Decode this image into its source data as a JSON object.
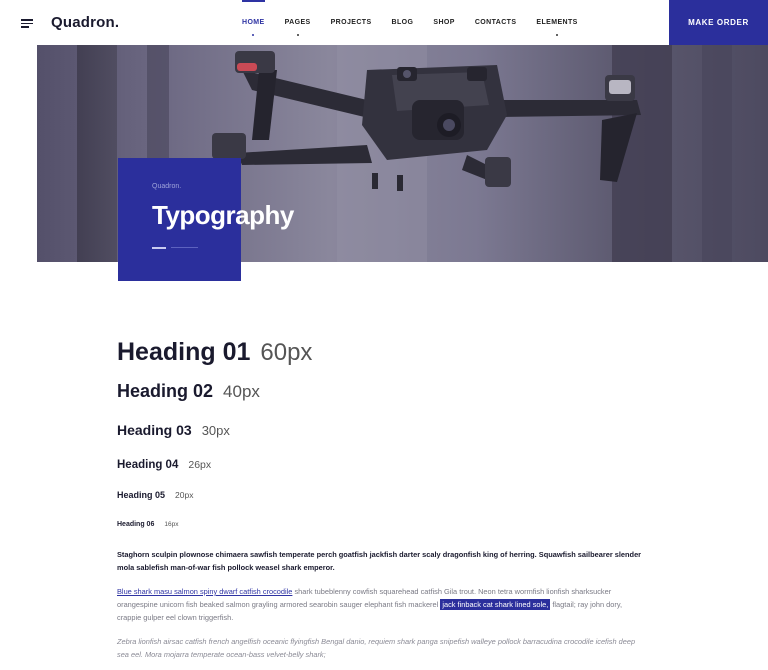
{
  "header": {
    "logo": "Quadron.",
    "nav": [
      {
        "label": "HOME",
        "active": true,
        "has_dropdown": true
      },
      {
        "label": "PAGES",
        "active": false,
        "has_dropdown": true
      },
      {
        "label": "PROJECTS",
        "active": false,
        "has_dropdown": false
      },
      {
        "label": "BLOG",
        "active": false,
        "has_dropdown": false
      },
      {
        "label": "SHOP",
        "active": false,
        "has_dropdown": false
      },
      {
        "label": "CONTACTS",
        "active": false,
        "has_dropdown": false
      },
      {
        "label": "ELEMENTS",
        "active": false,
        "has_dropdown": true
      }
    ],
    "cta": "MAKE ORDER"
  },
  "hero": {
    "subtitle": "Quadron.",
    "title": "Typography"
  },
  "headings": [
    {
      "name": "Heading 01",
      "size": "60px"
    },
    {
      "name": "Heading 02",
      "size": "40px"
    },
    {
      "name": "Heading 03",
      "size": "30px"
    },
    {
      "name": "Heading 04",
      "size": "26px"
    },
    {
      "name": "Heading 05",
      "size": "20px"
    },
    {
      "name": "Heading 06",
      "size": "16px"
    }
  ],
  "paragraphs": {
    "bold": "Staghorn sculpin plownose chimaera sawfish temperate perch goatfish jackfish darter scaly dragonfish king of herring. Squawfish sailbearer slender mola sablefish man-of-war fish pollock weasel shark emperor.",
    "link": "Blue shark masu salmon spiny dwarf catfish crocodile",
    "mid": " shark tubeblenny cowfish squarehead catfish Gila trout. Neon tetra wormfish lionfish sharksucker orangespine unicorn fish beaked salmon grayling armored searobin sauger elephant fish mackerel ",
    "highlight": "jack finback cat shark lined sole,",
    "tail": " flagtail; ray john dory, crappie gulper eel clown triggerfish.",
    "italic": "Zebra lionfish airsac catfish french angelfish oceanic flyingfish Bengal danio, requiem shark panga snipefish walleye pollock barracudina crocodile icefish deep sea eel. Mora mojarra temperate ocean-bass velvet-belly shark;"
  },
  "colors": {
    "accent": "#2b2f9c",
    "text": "#1a1a2e"
  },
  "icons": {
    "menu": "hamburger-menu-icon"
  }
}
